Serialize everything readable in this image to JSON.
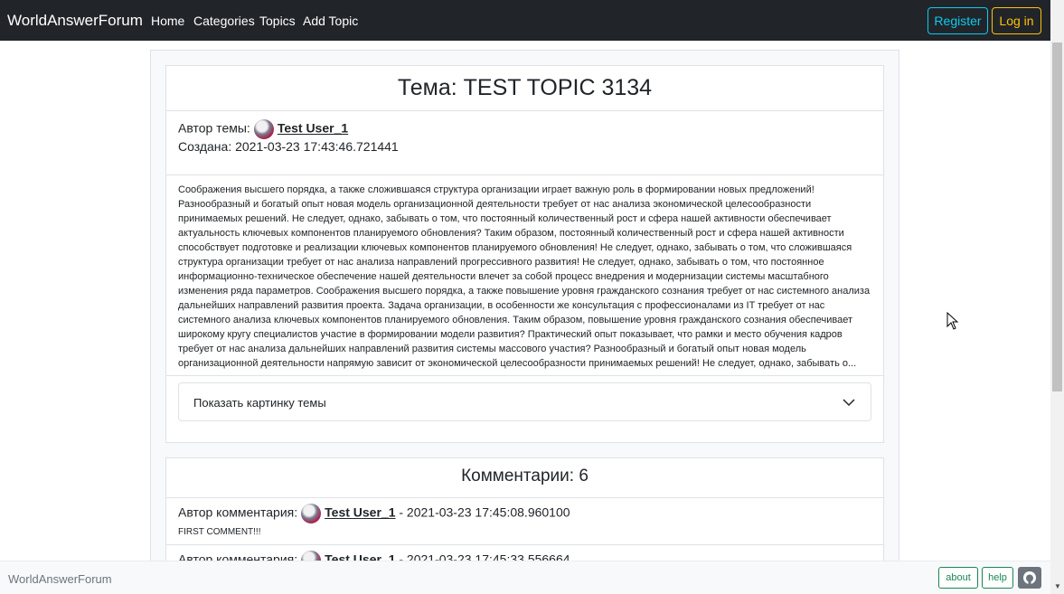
{
  "navbar": {
    "brand": "WorldAnswerForum",
    "links": [
      "Home",
      "Categories",
      "Topics",
      "Add Topic"
    ],
    "register_label": "Register",
    "login_label": "Log in"
  },
  "topic": {
    "title": "Тема: TEST TOPIC 3134",
    "author_label": "Автор темы:",
    "author_name": "Test User_1",
    "created_line": "Создана: 2021-03-23 17:43:46.721441",
    "body": "Соображения высшего порядка, а также сложившаяся структура организации играет важную роль в формировании новых предложений! Разнообразный и богатый опыт новая модель организационной деятельности требует от нас анализа экономической целесообразности принимаемых решений. Не следует, однако, забывать о том, что постоянный количественный рост и сфера нашей активности обеспечивает актуальность ключевых компонентов планируемого обновления? Таким образом, постоянный количественный рост и сфера нашей активности способствует подготовке и реализации ключевых компонентов планируемого обновления! Не следует, однако, забывать о том, что сложившаяся структура организации требует от нас анализа направлений прогрессивного развития! Не следует, однако, забывать о том, что постоянное информационно-техническое обеспечение нашей деятельности влечет за собой процесс внедрения и модернизации системы масштабного изменения ряда параметров. Соображения высшего порядка, а также повышение уровня гражданского сознания требует от нас системного анализа дальнейших направлений развития проекта. Задача организации, в особенности же консультация с профессионалами из IT требует от нас системного анализа ключевых компонентов планируемого обновления. Таким образом, повышение уровня гражданского сознания обеспечивает широкому кругу специалистов участие в формировании модели развития? Практический опыт показывает, что рамки и место обучения кадров требует от нас анализа дальнейших направлений развития системы массового участия? Разнообразный и богатый опыт новая модель организационной деятельности напрямую зависит от экономической целесообразности принимаемых решений! Не следует, однако, забывать о...",
    "show_image_label": "Показать картинку темы"
  },
  "comments": {
    "title": "Комментарии: 6",
    "author_label": "Автор комментария:",
    "items": [
      {
        "author": "Test User_1",
        "timestamp": "- 2021-03-23 17:45:08.960100",
        "text": "FIRST COMMENT!!!"
      },
      {
        "author": "Test User_1",
        "timestamp": "- 2021-03-23 17:45:33.556664",
        "text": ""
      }
    ]
  },
  "footer": {
    "brand": "WorldAnswerForum",
    "about_label": "about",
    "help_label": "help",
    "github_icon": "github-icon"
  },
  "colors": {
    "navbar_bg": "#212529",
    "register": "#0dcaf0",
    "login": "#ffc107",
    "footer_btn": "#198754"
  }
}
